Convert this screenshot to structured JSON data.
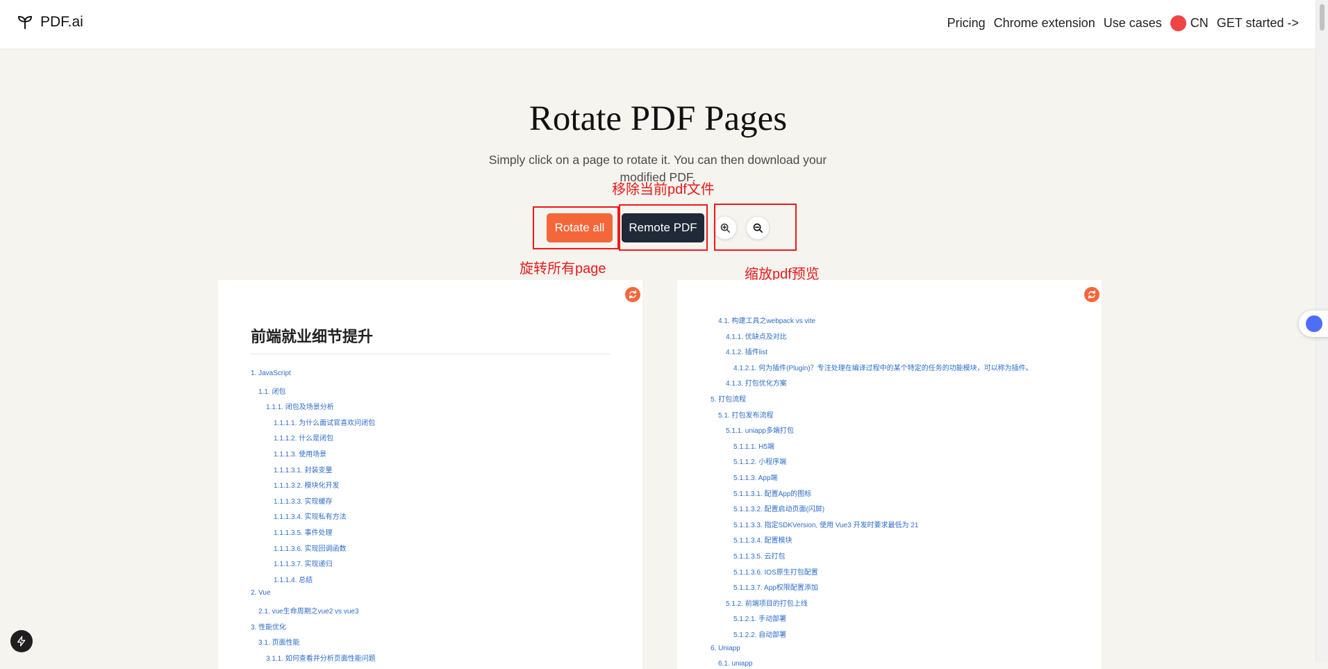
{
  "header": {
    "brand": "PDF.ai",
    "nav": [
      {
        "label": "Pricing"
      },
      {
        "label": "Chrome extension"
      },
      {
        "label": "Use cases"
      }
    ],
    "language": "CN",
    "cta": "GET started ->"
  },
  "hero": {
    "title": "Rotate PDF Pages",
    "subtitle": "Simply click on a page to rotate it. You can then download your modified PDF."
  },
  "toolbar": {
    "rotate_all": "Rotate all",
    "remove_pdf": "Remote PDF",
    "zoom_in_icon": "zoom-in-icon",
    "zoom_out_icon": "zoom-out-icon"
  },
  "annotations": {
    "remove": "移除当前pdf文件",
    "rotate": "旋转所有page",
    "zoom": "缩放pdf预览",
    "color": "#e8191a"
  },
  "colors": {
    "accent": "#f4673a",
    "dark": "#1f2937",
    "link": "#2b6ccc",
    "background": "#f6f4ef"
  },
  "pages": [
    {
      "title": "前端就业细节提升",
      "toc": [
        {
          "text": "1. JavaScript",
          "level": 0
        },
        {
          "text": "1.1. 闭包",
          "level": 1
        },
        {
          "text": "1.1.1. 闭包及场景分析",
          "level": 2
        },
        {
          "text": "1.1.1.1. 为什么面试官喜欢问闭包",
          "level": 3
        },
        {
          "text": "1.1.1.2. 什么是闭包",
          "level": 3
        },
        {
          "text": "1.1.1.3. 使用场景",
          "level": 3
        },
        {
          "text": "1.1.1.3.1. 封装变量",
          "level": 3
        },
        {
          "text": "1.1.1.3.2. 模块化开发",
          "level": 3
        },
        {
          "text": "1.1.1.3.3. 实现缓存",
          "level": 3
        },
        {
          "text": "1.1.1.3.4. 实现私有方法",
          "level": 3
        },
        {
          "text": "1.1.1.3.5. 事件处理",
          "level": 3
        },
        {
          "text": "1.1.1.3.6. 实现回调函数",
          "level": 3
        },
        {
          "text": "1.1.1.3.7. 实现递归",
          "level": 3
        },
        {
          "text": "1.1.1.4. 总结",
          "level": 3
        },
        {
          "text": "2. Vue",
          "level": 0
        },
        {
          "text": "2.1. vue生命周期之vue2 vs vue3",
          "level": 1
        },
        {
          "text": "3. 性能优化",
          "level": 0
        },
        {
          "text": "3.1. 页面性能",
          "level": 1
        },
        {
          "text": "3.1.1. 如何查看并分析页面性能问题",
          "level": 2
        }
      ]
    },
    {
      "title": "",
      "toc": [
        {
          "text": "4.1. 构建工具之webpack vs vite",
          "level": 1
        },
        {
          "text": "4.1.1. 优缺点及对比",
          "level": 2
        },
        {
          "text": "4.1.2. 插件list",
          "level": 2
        },
        {
          "text": "4.1.2.1. 何为插件(Plugin)？专注处理在编译过程中的某个特定的任务的功能模块，可以称为插件。",
          "level": 3
        },
        {
          "text": "4.1.3. 打包优化方案",
          "level": 2
        },
        {
          "text": "5. 打包流程",
          "level": 0
        },
        {
          "text": "5.1. 打包发布流程",
          "level": 1
        },
        {
          "text": "5.1.1. uniapp多端打包",
          "level": 2
        },
        {
          "text": "5.1.1.1. H5端",
          "level": 3
        },
        {
          "text": "5.1.1.2. 小程序端",
          "level": 3
        },
        {
          "text": "5.1.1.3. App端",
          "level": 3
        },
        {
          "text": "5.1.1.3.1. 配置App的图标",
          "level": 3
        },
        {
          "text": "5.1.1.3.2. 配置启动页面(闪屏)",
          "level": 3
        },
        {
          "text": "5.1.1.3.3. 指定SDKVersion, 使用 Vue3 开发时要求最低为 21",
          "level": 3
        },
        {
          "text": "5.1.1.3.4. 配置模块",
          "level": 3
        },
        {
          "text": "5.1.1.3.5. 云打包",
          "level": 3
        },
        {
          "text": "5.1.1.3.6. IOS原生打包配置",
          "level": 3
        },
        {
          "text": "5.1.1.3.7. App权限配置添加",
          "level": 3
        },
        {
          "text": "5.1.2. 前端项目的打包上线",
          "level": 2
        },
        {
          "text": "5.1.2.1. 手动部署",
          "level": 3
        },
        {
          "text": "5.1.2.2. 自动部署",
          "level": 3
        },
        {
          "text": "6. Uniapp",
          "level": 0
        },
        {
          "text": "6.1. uniapp",
          "level": 1
        }
      ]
    }
  ]
}
